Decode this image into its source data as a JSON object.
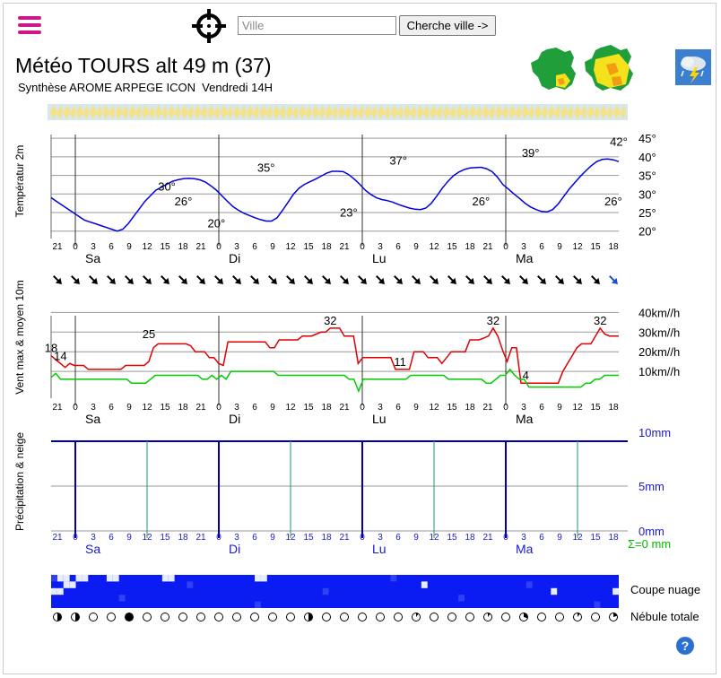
{
  "header": {
    "search_placeholder": "Ville",
    "search_button": "Cherche ville ->",
    "title": "Météo TOURS alt 49 m (37)",
    "subtitle": "Synthèse AROME ARPEGE ICON  Vendredi 14H",
    "help_label": "?"
  },
  "colors": {
    "temperature": "#0000dd",
    "wind_max": "#e00000",
    "wind_avg": "#00cc00",
    "precip_axis": "#0000aa",
    "precip_total": "#00bb00",
    "brand": "#d0178a"
  },
  "chart_data": [
    {
      "type": "line",
      "ylabel": "Températur 2m",
      "y_ticks": [
        "45°",
        "40°",
        "35°",
        "30°",
        "25°",
        "20°"
      ],
      "ylim": [
        18,
        46
      ],
      "x_ticks": [
        "21",
        "0",
        "3",
        "6",
        "9",
        "12",
        "15",
        "18",
        "21",
        "0",
        "3",
        "6",
        "9",
        "12",
        "15",
        "18",
        "21",
        "0",
        "3",
        "6",
        "9",
        "12",
        "15",
        "18",
        "21",
        "0",
        "3",
        "6",
        "9",
        "12",
        "15",
        "18"
      ],
      "day_labels": [
        "Sa",
        "Di",
        "Lu",
        "Ma"
      ],
      "series": [
        {
          "values": [
            29,
            28,
            27,
            26,
            25,
            24,
            23,
            22.5,
            22,
            21.5,
            21,
            20.5,
            20,
            20.5,
            22,
            24,
            26,
            28,
            29.5,
            31,
            31.8,
            32.6,
            33.4,
            33.8,
            34.1,
            34.2,
            34.1,
            33.8,
            33.2,
            32.2,
            31,
            29.5,
            28,
            26.6,
            25.6,
            24.8,
            24.2,
            23.6,
            23.1,
            22.7,
            22.7,
            23.6,
            25.6,
            27.8,
            30,
            31.6,
            32.6,
            33.3,
            34,
            34.8,
            35.6,
            36.1,
            36.1,
            36,
            35.2,
            34,
            32.6,
            31,
            29.9,
            29,
            28.5,
            28.2,
            27.8,
            27.2,
            26.7,
            26.2,
            25.9,
            25.8,
            26.2,
            27.5,
            29.5,
            31.6,
            33.4,
            34.9,
            35.9,
            36.6,
            37,
            37.1,
            37.2,
            36.8,
            36,
            34.5,
            32.5,
            31.3,
            30,
            28.8,
            27.5,
            26.5,
            25.8,
            25.3,
            25.2,
            25.8,
            27.3,
            29.3,
            31.3,
            33,
            34.7,
            36.2,
            37.6,
            38.7,
            39.3,
            39.4,
            39.2,
            38.7
          ]
        }
      ],
      "annotations": [
        {
          "label": "30°",
          "x": 21,
          "y": 30
        },
        {
          "label": "26°",
          "x": 24,
          "y": 26
        },
        {
          "label": "20°",
          "x": 30,
          "y": 20
        },
        {
          "label": "35°",
          "x": 39,
          "y": 35
        },
        {
          "label": "23°",
          "x": 54,
          "y": 23
        },
        {
          "label": "37°",
          "x": 63,
          "y": 37
        },
        {
          "label": "26°",
          "x": 78,
          "y": 26
        },
        {
          "label": "39°",
          "x": 87,
          "y": 39
        },
        {
          "label": "26°",
          "x": 102,
          "y": 26
        },
        {
          "label": "42°",
          "x": 111,
          "y": 42
        }
      ]
    },
    {
      "type": "line",
      "ylabel": "Vent max & moyen 10m",
      "y_ticks": [
        "40km//h",
        "30km//h",
        "20km//h",
        "10km//h"
      ],
      "ylim": [
        0,
        42
      ],
      "wind_arrow_directions_deg": [
        315,
        315,
        315,
        315,
        315,
        315,
        315,
        315,
        315,
        315,
        315,
        315,
        315,
        315,
        315,
        315,
        315,
        315,
        315,
        315,
        315,
        315,
        315,
        315,
        315,
        315,
        315,
        315,
        315,
        315,
        315,
        315
      ],
      "series": [
        {
          "name": "max",
          "values": [
            18,
            16,
            14,
            12,
            14,
            13,
            13,
            13,
            11,
            11,
            11,
            11,
            11,
            11,
            11,
            11,
            13,
            13,
            13,
            13,
            13,
            15,
            22,
            24,
            24,
            24,
            24,
            24,
            24,
            24,
            23,
            20,
            20,
            20,
            17,
            17,
            14,
            13,
            25,
            25,
            25,
            25,
            25,
            25,
            25,
            25,
            25,
            22,
            22,
            26,
            26,
            26,
            26,
            26,
            28,
            28,
            28,
            29,
            30,
            30,
            32,
            32,
            32,
            28,
            28,
            28,
            14,
            17,
            17,
            17,
            17,
            17,
            17,
            17,
            11,
            11,
            11,
            11,
            20,
            20,
            20,
            17,
            17,
            17,
            14,
            17,
            20,
            20,
            20,
            20,
            26,
            26,
            26,
            27,
            28,
            32,
            28,
            21,
            15,
            22,
            22,
            4,
            4,
            4,
            4,
            4,
            4,
            4,
            4,
            4,
            10,
            14,
            18,
            22,
            24,
            24,
            24,
            28,
            32,
            29,
            28,
            28,
            28
          ]
        },
        {
          "name": "moyen",
          "values": [
            7,
            9,
            6,
            6,
            6,
            6,
            6,
            6,
            6,
            6,
            6,
            6,
            6,
            6,
            6,
            6,
            6,
            4,
            4,
            4,
            4,
            6,
            8,
            8,
            8,
            8,
            8,
            8,
            8,
            8,
            8,
            8,
            6,
            6,
            8,
            6,
            8,
            6,
            10,
            10,
            10,
            10,
            10,
            10,
            10,
            10,
            10,
            10,
            8,
            8,
            8,
            8,
            8,
            8,
            8,
            8,
            8,
            8,
            8,
            8,
            8,
            8,
            8,
            6,
            6,
            0,
            6,
            6,
            6,
            6,
            6,
            6,
            6,
            6,
            6,
            6,
            8,
            8,
            8,
            8,
            8,
            8,
            8,
            8,
            6,
            6,
            6,
            6,
            6,
            6,
            6,
            6,
            4,
            4,
            6,
            8,
            8,
            11,
            8,
            6,
            6,
            2,
            2,
            2,
            2,
            2,
            2,
            2,
            2,
            2,
            2,
            2,
            2,
            4,
            4,
            6,
            6,
            8,
            8,
            8,
            8
          ]
        }
      ],
      "annotations": [
        {
          "label": "18",
          "x": 0,
          "y": 18
        },
        {
          "label": "14",
          "x": 2,
          "y": 14
        },
        {
          "label": "25",
          "x": 21,
          "y": 25
        },
        {
          "label": "32",
          "x": 60,
          "y": 32
        },
        {
          "label": "11",
          "x": 75,
          "y": 11
        },
        {
          "label": "32",
          "x": 95,
          "y": 32
        },
        {
          "label": "4",
          "x": 102,
          "y": 4
        },
        {
          "label": "32",
          "x": 118,
          "y": 32
        }
      ]
    },
    {
      "type": "bar",
      "ylabel": "Précipitation & neige",
      "y_ticks": [
        "10mm",
        "5mm",
        "0mm"
      ],
      "ylim": [
        0,
        10
      ],
      "values": [],
      "total_label": "Σ=0 mm"
    }
  ],
  "clouds": {
    "label_coupe": "Coupe nuage",
    "label_nebule": "Nébule totale",
    "nebule_values": [
      0.5,
      0.5,
      0,
      0,
      1,
      0,
      0,
      0,
      0,
      0,
      0,
      0,
      0,
      0,
      0.5,
      0,
      0,
      0,
      0,
      0,
      0.1,
      0,
      0,
      0,
      0.1,
      0,
      0.3,
      0,
      0,
      0.1,
      0,
      0.2
    ]
  }
}
